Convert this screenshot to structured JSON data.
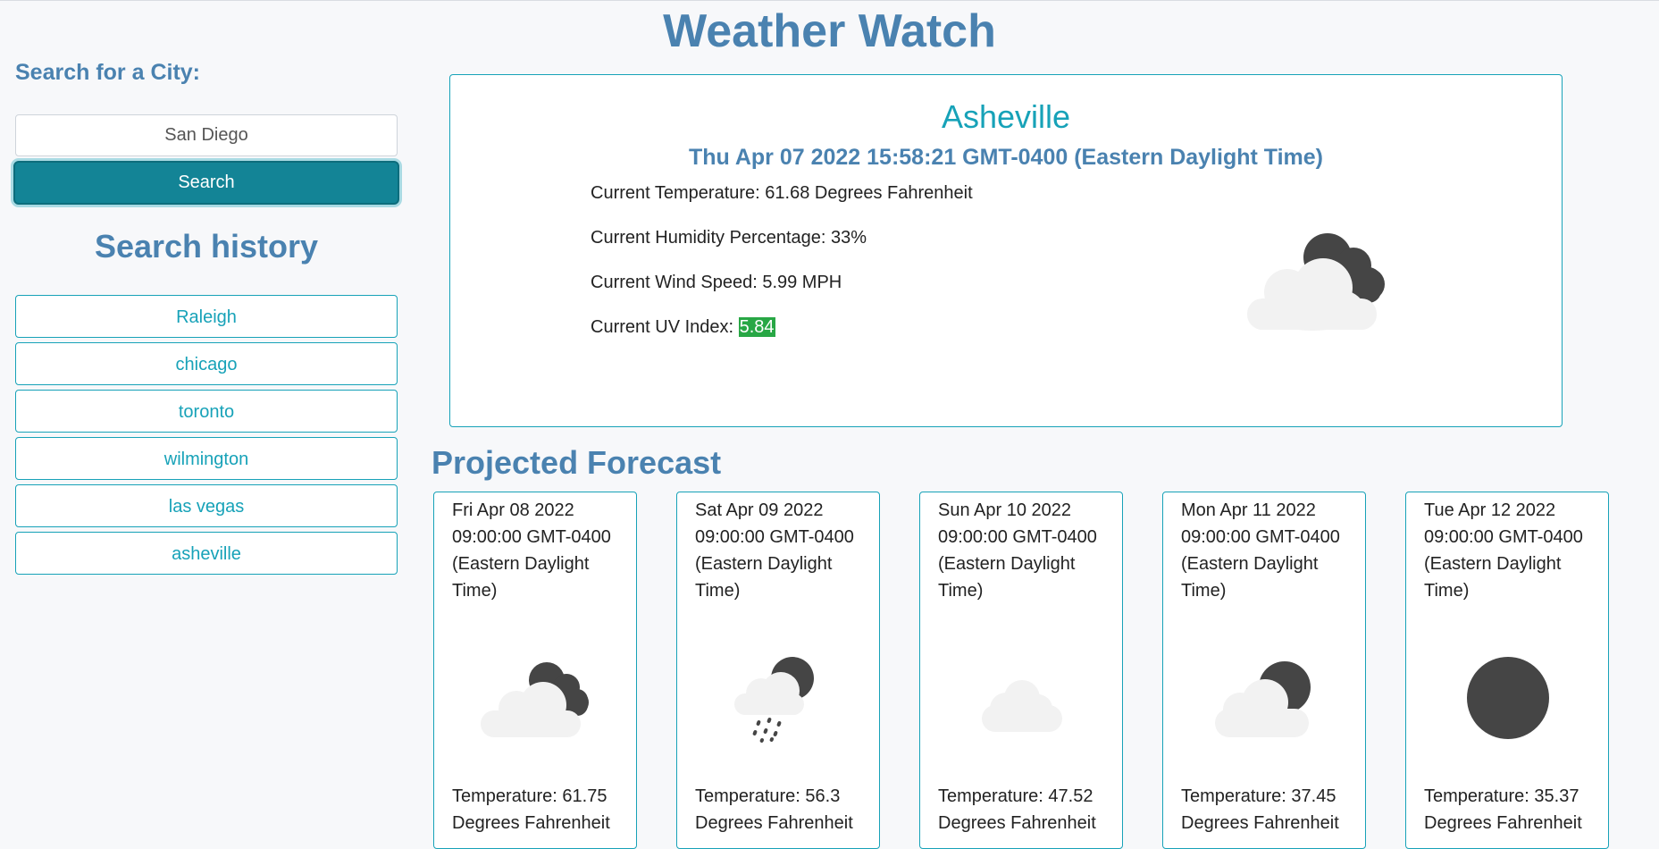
{
  "app": {
    "title": "Weather Watch"
  },
  "sidebar": {
    "search_label": "Search for a City:",
    "search_value": "San Diego",
    "search_button": "Search",
    "history_title": "Search history",
    "history": [
      "Raleigh",
      "chicago",
      "toronto",
      "wilmington",
      "las vegas",
      "asheville"
    ]
  },
  "current": {
    "city": "Asheville",
    "date": "Thu Apr 07 2022 15:58:21 GMT-0400 (Eastern Daylight Time)",
    "temperature": "Current Temperature: 61.68 Degrees Fahrenheit",
    "humidity": "Current Humidity Percentage: 33%",
    "wind": "Current Wind Speed: 5.99 MPH",
    "uv_label": "Current UV Index: ",
    "uv_value": "5.84",
    "uv_color": "#28a745",
    "icon": "cloudy-night-icon"
  },
  "forecast": {
    "title": "Projected Forecast",
    "days": [
      {
        "date": "Fri Apr 08 2022 09:00:00 GMT-0400 (Eastern Daylight Time)",
        "icon": "cloudy-night-icon",
        "temperature": "Temperature: 61.75 Degrees Fahrenheit"
      },
      {
        "date": "Sat Apr 09 2022 09:00:00 GMT-0400 (Eastern Daylight Time)",
        "icon": "rain-night-icon",
        "temperature": "Temperature: 56.3 Degrees Fahrenheit"
      },
      {
        "date": "Sun Apr 10 2022 09:00:00 GMT-0400 (Eastern Daylight Time)",
        "icon": "cloud-icon",
        "temperature": "Temperature: 47.52 Degrees Fahrenheit"
      },
      {
        "date": "Mon Apr 11 2022 09:00:00 GMT-0400 (Eastern Daylight Time)",
        "icon": "partly-cloudy-night-icon",
        "temperature": "Temperature: 37.45 Degrees Fahrenheit"
      },
      {
        "date": "Tue Apr 12 2022 09:00:00 GMT-0400 (Eastern Daylight Time)",
        "icon": "clear-night-icon",
        "temperature": "Temperature: 35.37 Degrees Fahrenheit"
      }
    ]
  },
  "colors": {
    "heading": "#4a82b0",
    "accent": "#17a2b8",
    "button": "#138496",
    "icon_dark": "#454545",
    "icon_light": "#f2f2f2"
  }
}
